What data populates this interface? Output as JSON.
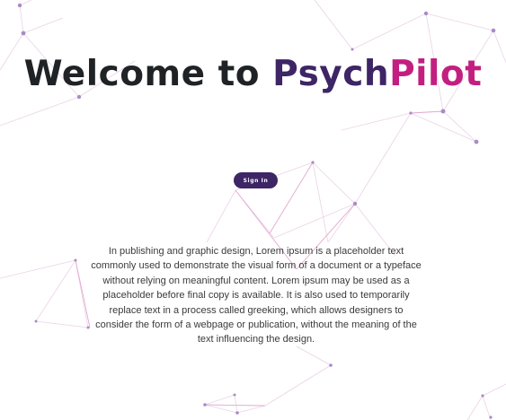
{
  "hero": {
    "title_part1": "Welcome to ",
    "title_part2": "Psych",
    "title_part3": "Pilot"
  },
  "auth": {
    "signin_label": "Sign In"
  },
  "content": {
    "description": "In publishing and graphic design, Lorem ipsum is a placeholder text commonly used to demonstrate the visual form of a document or a typeface without relying on meaningful content. Lorem ipsum may be used as a placeholder before final copy is available. It is also used to temporarily replace text in a process called greeking, which allows designers to consider the form of a webpage or publication, without the meaning of the text influencing the design."
  },
  "colors": {
    "title_dark": "#1f2326",
    "brand_purple": "#3d2566",
    "brand_magenta": "#c21f80",
    "network_node": "#a98bc8",
    "network_line": "#e6b6d6"
  }
}
